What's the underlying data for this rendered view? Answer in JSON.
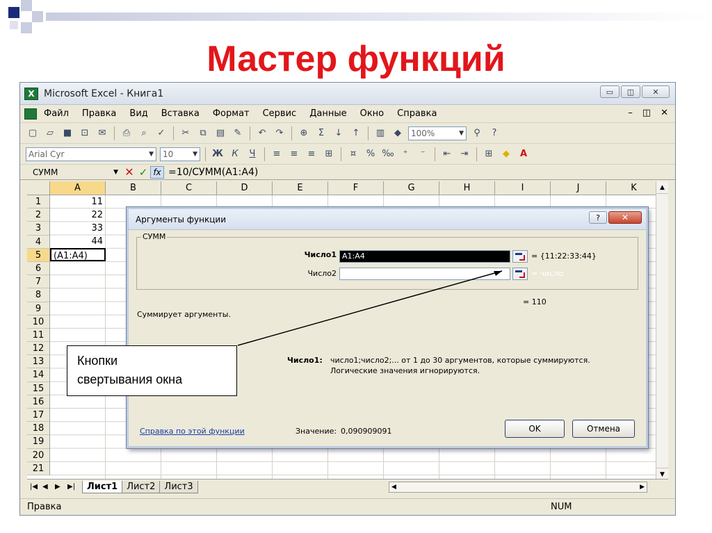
{
  "slide": {
    "title": "Мастер функций"
  },
  "excel": {
    "title": "Microsoft Excel - Книга1",
    "menu": [
      "Файл",
      "Правка",
      "Вид",
      "Вставка",
      "Формат",
      "Сервис",
      "Данные",
      "Окно",
      "Справка"
    ],
    "font_name": "Arial Cyr",
    "font_size": "10",
    "zoom": "100%",
    "name_box": "СУММ",
    "formula": "=10/СУММ(A1:A4)",
    "columns": [
      "A",
      "B",
      "C",
      "D",
      "E",
      "F",
      "G",
      "H",
      "I",
      "J",
      "K"
    ],
    "rows": [
      "1",
      "2",
      "3",
      "4",
      "5",
      "6",
      "7",
      "8",
      "9",
      "10",
      "11",
      "12",
      "13",
      "14",
      "15",
      "16",
      "17",
      "18",
      "19",
      "20",
      "21"
    ],
    "cells_a": [
      "11",
      "22",
      "33",
      "44",
      "(A1:A4)"
    ],
    "sheets": [
      "Лист1",
      "Лист2",
      "Лист3"
    ],
    "status_left": "Правка",
    "status_num": "NUM"
  },
  "dialog": {
    "title": "Аргументы функции",
    "function_group": "СУММ",
    "arg1_label": "Число1",
    "arg1_value": "A1:A4",
    "arg1_result": "= {11:22:33:44}",
    "arg2_label": "Число2",
    "arg2_value": "",
    "arg2_result": "= число",
    "total_result": "= 110",
    "description": "Суммирует аргументы.",
    "arg_help_label": "Число1:",
    "arg_help_line1": "число1;число2;... от 1 до 30 аргументов, которые суммируются.",
    "arg_help_line2": "Логические значения игнорируются.",
    "help_link": "Справка по этой функции",
    "value_label": "Значение:",
    "value": "0,090909091",
    "ok": "OK",
    "cancel": "Отмена"
  },
  "callout": {
    "line1": "Кнопки",
    "line2": "свертывания окна"
  }
}
